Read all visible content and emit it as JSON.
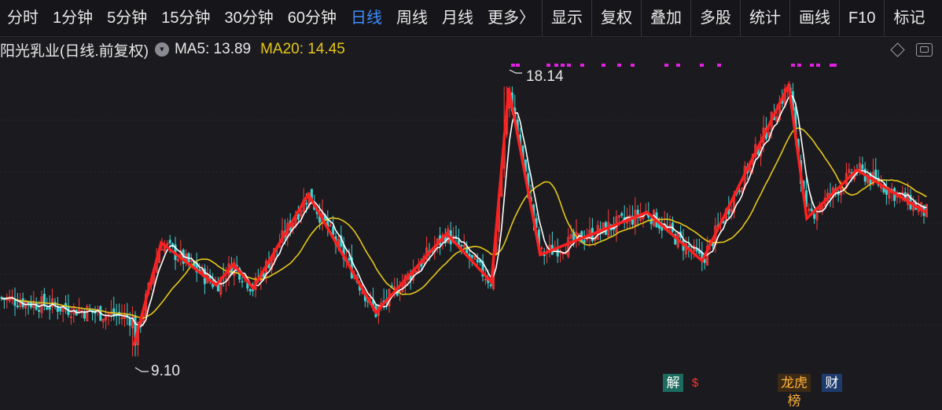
{
  "toolbar": {
    "tabs": [
      {
        "label": "分时"
      },
      {
        "label": "1分钟"
      },
      {
        "label": "5分钟"
      },
      {
        "label": "15分钟"
      },
      {
        "label": "30分钟"
      },
      {
        "label": "60分钟"
      },
      {
        "label": "日线"
      },
      {
        "label": "周线"
      },
      {
        "label": "月线"
      },
      {
        "label": "更多〉"
      }
    ],
    "active_tab": "日线",
    "tools": [
      {
        "label": "显示"
      },
      {
        "label": "复权"
      },
      {
        "label": "叠加"
      },
      {
        "label": "多股"
      },
      {
        "label": "统计"
      },
      {
        "label": "画线"
      },
      {
        "label": "F10"
      },
      {
        "label": "标记"
      }
    ]
  },
  "info": {
    "stock_title": "阳光乳业(日线.前复权)",
    "ma5_text": "MA5: 13.89",
    "ma20_text": "MA20: 14.45",
    "ma20_color": "#e6c619"
  },
  "chart_data": {
    "type": "candlestick",
    "high_label": "18.14",
    "low_label": "9.10",
    "up_color": "#ff3b3b",
    "down_color": "#3fd4d4",
    "ma5_color": "#ffffff",
    "ma20_color": "#e6c619",
    "zigzag_color": "#ff2020",
    "signal_color": "#e020e0",
    "y_range": [
      8.6,
      18.7
    ],
    "zigzag": [
      [
        170,
        9.5
      ],
      [
        205,
        12.9
      ],
      [
        275,
        11.5
      ],
      [
        297,
        12.2
      ],
      [
        322,
        11.4
      ],
      [
        392,
        14.5
      ],
      [
        478,
        10.6
      ],
      [
        568,
        13.2
      ],
      [
        625,
        11.6
      ],
      [
        647,
        18.0
      ],
      [
        687,
        12.5
      ],
      [
        823,
        13.9
      ],
      [
        893,
        12.3
      ],
      [
        1003,
        18.1
      ],
      [
        1026,
        13.7
      ],
      [
        1090,
        15.3
      ],
      [
        1177,
        13.9
      ]
    ],
    "events": [
      {
        "label": "解",
        "type": "unlock"
      },
      {
        "label": "$",
        "type": "dividend"
      },
      {
        "label": "龙虎榜",
        "type": "dragon-tiger"
      },
      {
        "label": "财",
        "type": "financial"
      }
    ]
  }
}
